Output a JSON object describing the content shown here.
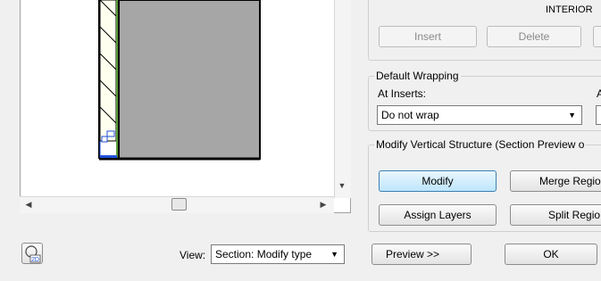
{
  "layer_header": {
    "interior_label": "INTERIOR"
  },
  "layer_buttons": {
    "insert": "Insert",
    "delete": "Delete"
  },
  "default_wrapping": {
    "title": "Default Wrapping",
    "at_inserts_label": "At Inserts:",
    "at_inserts_value": "Do not wrap",
    "at_ends_label_partial": "A"
  },
  "modify_vertical": {
    "title": "Modify Vertical Structure (Section Preview o",
    "modify": "Modify",
    "merge_regions": "Merge Regio",
    "assign_layers": "Assign Layers",
    "split_region": "Split Regio"
  },
  "footer": {
    "view_label": "View:",
    "view_value": "Section: Modify type",
    "preview": "Preview >>",
    "ok": "OK"
  },
  "icons": {
    "view_2d": "2d-view-icon",
    "dropdown": "chevron-down-icon",
    "scroll_left": "scroll-left-icon",
    "scroll_right": "scroll-right-icon",
    "scroll_down": "scroll-down-icon"
  },
  "colors": {
    "wall_core": "#a6a6a6",
    "hatch_fill": "#fffff0",
    "green_line": "#5b9d3a",
    "blue_line": "#1f4fd6",
    "focus_border": "#3c7fb1"
  }
}
